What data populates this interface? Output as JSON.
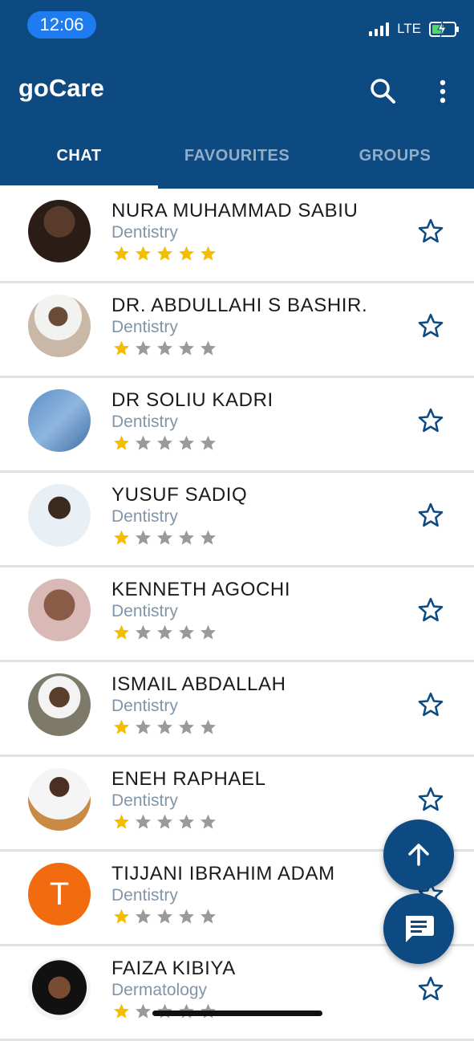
{
  "status_bar": {
    "time": "12:06",
    "network": "LTE"
  },
  "app": {
    "title": "goCare",
    "search_icon": "search-icon",
    "more_icon": "more-vert-icon",
    "brand_color": "#0d4a82"
  },
  "tabs": [
    {
      "label": "CHAT",
      "active": true
    },
    {
      "label": "FAVOURITES",
      "active": false
    },
    {
      "label": "GROUPS",
      "active": false
    }
  ],
  "doctors": [
    {
      "name": "NURA MUHAMMAD SABIU",
      "specialty": "Dentistry",
      "rating": 5,
      "favourite": false,
      "avatar_initial": ""
    },
    {
      "name": "DR. ABDULLAHI S BASHIR.",
      "specialty": "Dentistry",
      "rating": 1,
      "favourite": false,
      "avatar_initial": ""
    },
    {
      "name": "DR SOLIU KADRI",
      "specialty": "Dentistry",
      "rating": 1,
      "favourite": false,
      "avatar_initial": ""
    },
    {
      "name": "YUSUF SADIQ",
      "specialty": "Dentistry",
      "rating": 1,
      "favourite": false,
      "avatar_initial": ""
    },
    {
      "name": "KENNETH AGOCHI",
      "specialty": "Dentistry",
      "rating": 1,
      "favourite": false,
      "avatar_initial": ""
    },
    {
      "name": "ISMAIL ABDALLAH",
      "specialty": "Dentistry",
      "rating": 1,
      "favourite": false,
      "avatar_initial": ""
    },
    {
      "name": "ENEH RAPHAEL",
      "specialty": "Dentistry",
      "rating": 1,
      "favourite": false,
      "avatar_initial": ""
    },
    {
      "name": "TIJJANI IBRAHIM ADAM",
      "specialty": "Dentistry",
      "rating": 1,
      "favourite": false,
      "avatar_initial": "T"
    },
    {
      "name": "FAIZA KIBIYA",
      "specialty": "Dermatology",
      "rating": 1,
      "favourite": false,
      "avatar_initial": ""
    }
  ],
  "fabs": {
    "scroll_top_icon": "arrow-up-icon",
    "new_chat_icon": "chat-icon"
  },
  "colors": {
    "star_filled": "#f5bd00",
    "star_empty": "#9a9a9a",
    "specialty_text": "#8095a8"
  }
}
